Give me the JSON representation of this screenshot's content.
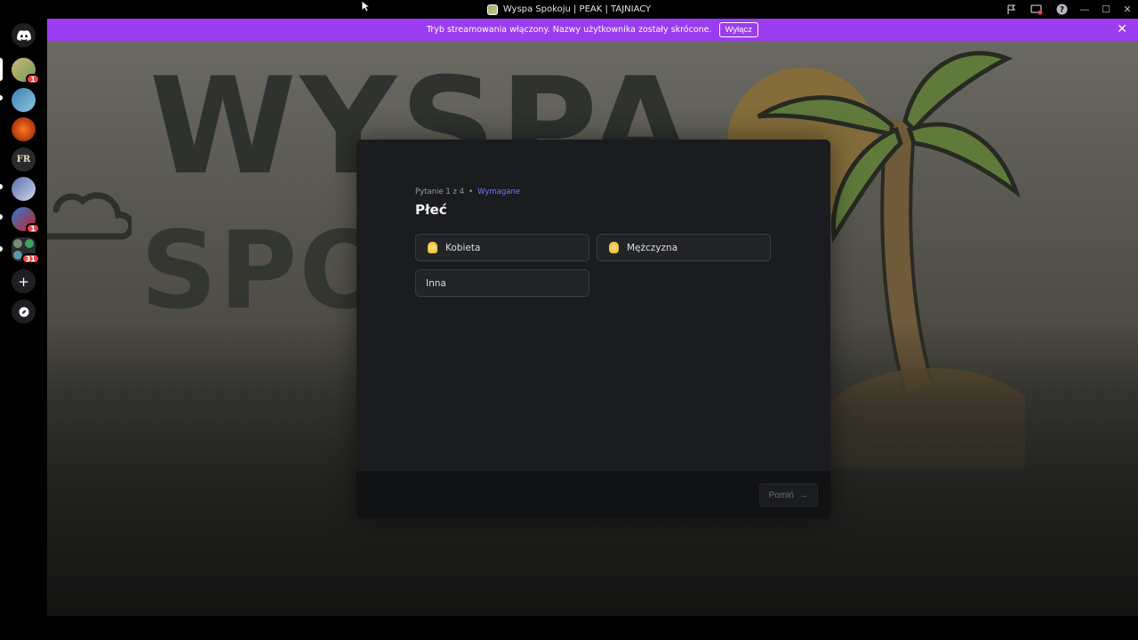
{
  "window": {
    "title": "Wyspa Spokoju | PEAK | TAJNIACY"
  },
  "titlebar_icons": [
    "flag-icon",
    "screen-share-icon",
    "help-icon"
  ],
  "window_controls": {
    "minimize": "—",
    "maximize": "☐",
    "close": "✕"
  },
  "rail": {
    "servers": [
      {
        "name": "discord-home",
        "badge": ""
      },
      {
        "name": "wyspa-spokoju",
        "badge": "1",
        "active": true
      },
      {
        "name": "server-2",
        "badge": ""
      },
      {
        "name": "server-3",
        "badge": ""
      },
      {
        "name": "server-fr",
        "label": "FR",
        "badge": ""
      },
      {
        "name": "server-5",
        "badge": ""
      },
      {
        "name": "server-6",
        "badge": "1"
      },
      {
        "name": "server-folder",
        "badge": "31"
      }
    ],
    "add_server": "+",
    "discover": "⊘"
  },
  "banner": {
    "text": "Tryb streamowania włączony. Nazwy użytkownika zostały skrócone.",
    "button": "Wyłącz",
    "close": "✕"
  },
  "background": {
    "word1": "WYSPA",
    "word2": "SPO"
  },
  "modal": {
    "progress": "Pytanie 1 z 4",
    "separator": "•",
    "required": "Wymagane",
    "question": "Płeć",
    "options": [
      {
        "label": "Kobieta",
        "icon": "woman-emoji-icon"
      },
      {
        "label": "Mężczyzna",
        "icon": "man-emoji-icon"
      },
      {
        "label": "Inna",
        "icon": ""
      }
    ],
    "skip": "Pomiń",
    "skip_arrow": "→"
  },
  "colors": {
    "banner": "#9b3cf0",
    "accent_required": "#6b79f6",
    "modal_bg": "#1b1c1f",
    "badge": "#ed4245"
  }
}
